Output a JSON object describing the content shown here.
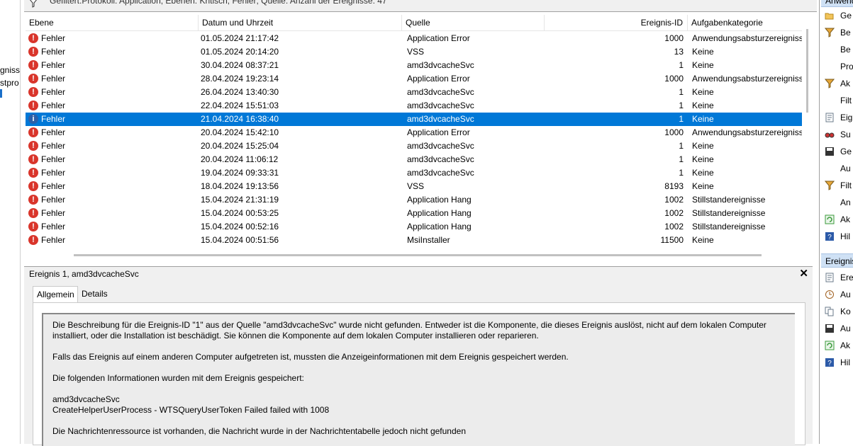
{
  "left_tree": {
    "fragments": [
      "gnisse",
      "stpro"
    ]
  },
  "filterbar": {
    "text": "Gefiltert:Protokoll: Application; Ebenen: Kritisch, Fehler; Quelle: Anzahl der Ereignisse: 47"
  },
  "table": {
    "headers": {
      "level": "Ebene",
      "date": "Datum und Uhrzeit",
      "source": "Quelle",
      "id": "Ereignis-ID",
      "category": "Aufgabenkategorie"
    },
    "rows": [
      {
        "level": "Fehler",
        "date": "01.05.2024 21:17:42",
        "source": "Application Error",
        "id": "1000",
        "category": "Anwendungsabsturzereignisse"
      },
      {
        "level": "Fehler",
        "date": "01.05.2024 20:14:20",
        "source": "VSS",
        "id": "13",
        "category": "Keine"
      },
      {
        "level": "Fehler",
        "date": "30.04.2024 08:37:21",
        "source": "amd3dvcacheSvc",
        "id": "1",
        "category": "Keine"
      },
      {
        "level": "Fehler",
        "date": "28.04.2024 19:23:14",
        "source": "Application Error",
        "id": "1000",
        "category": "Anwendungsabsturzereignisse"
      },
      {
        "level": "Fehler",
        "date": "26.04.2024 13:40:30",
        "source": "amd3dvcacheSvc",
        "id": "1",
        "category": "Keine"
      },
      {
        "level": "Fehler",
        "date": "22.04.2024 15:51:03",
        "source": "amd3dvcacheSvc",
        "id": "1",
        "category": "Keine"
      },
      {
        "level": "Fehler",
        "date": "21.04.2024 16:38:40",
        "source": "amd3dvcacheSvc",
        "id": "1",
        "category": "Keine",
        "selected": true
      },
      {
        "level": "Fehler",
        "date": "20.04.2024 15:42:10",
        "source": "Application Error",
        "id": "1000",
        "category": "Anwendungsabsturzereignisse"
      },
      {
        "level": "Fehler",
        "date": "20.04.2024 15:25:04",
        "source": "amd3dvcacheSvc",
        "id": "1",
        "category": "Keine"
      },
      {
        "level": "Fehler",
        "date": "20.04.2024 11:06:12",
        "source": "amd3dvcacheSvc",
        "id": "1",
        "category": "Keine"
      },
      {
        "level": "Fehler",
        "date": "19.04.2024 09:33:31",
        "source": "amd3dvcacheSvc",
        "id": "1",
        "category": "Keine"
      },
      {
        "level": "Fehler",
        "date": "18.04.2024 19:13:56",
        "source": "VSS",
        "id": "8193",
        "category": "Keine"
      },
      {
        "level": "Fehler",
        "date": "15.04.2024 21:31:19",
        "source": "Application Hang",
        "id": "1002",
        "category": "Stillstandereignisse"
      },
      {
        "level": "Fehler",
        "date": "15.04.2024 00:53:25",
        "source": "Application Hang",
        "id": "1002",
        "category": "Stillstandereignisse"
      },
      {
        "level": "Fehler",
        "date": "15.04.2024 00:52:16",
        "source": "Application Hang",
        "id": "1002",
        "category": "Stillstandereignisse"
      },
      {
        "level": "Fehler",
        "date": "15.04.2024 00:51:56",
        "source": "MsiInstaller",
        "id": "11500",
        "category": "Keine"
      }
    ]
  },
  "detail": {
    "title": "Ereignis 1, amd3dvcacheSvc",
    "close": "✕",
    "tabs": {
      "general": "Allgemein",
      "details": "Details"
    },
    "paragraphs": [
      "Die Beschreibung für die Ereignis-ID \"1\" aus der Quelle \"amd3dvcacheSvc\" wurde nicht gefunden. Entweder ist die Komponente, die dieses Ereignis auslöst, nicht auf dem lokalen Computer installiert, oder die Installation ist beschädigt. Sie können die Komponente auf dem lokalen Computer installieren oder reparieren.",
      "Falls das Ereignis auf einem anderen Computer aufgetreten ist, mussten die Anzeigeinformationen mit dem Ereignis gespeichert werden.",
      "Die folgenden Informationen wurden mit dem Ereignis gespeichert:",
      "amd3dvcacheSvc\nCreateHelperUserProcess - WTSQueryUserToken Failed failed with 1008",
      "Die Nachrichtenressource ist vorhanden, die Nachricht wurde in der Nachrichtentabelle jedoch nicht gefunden"
    ]
  },
  "right_pane": {
    "section1": "Anwend",
    "items1": [
      {
        "icon": "folder-open-icon",
        "label": "Ge"
      },
      {
        "icon": "filter-icon",
        "label": "Be"
      },
      {
        "icon": "",
        "label": "Be"
      },
      {
        "icon": "",
        "label": "Pro"
      },
      {
        "icon": "filter-icon",
        "label": "Ak"
      },
      {
        "icon": "",
        "label": "Filt"
      },
      {
        "icon": "properties-icon",
        "label": "Eig"
      },
      {
        "icon": "find-icon",
        "label": "Su"
      },
      {
        "icon": "save-icon",
        "label": "Ge"
      },
      {
        "icon": "",
        "label": "Au"
      },
      {
        "icon": "filter-icon",
        "label": "Filt"
      },
      {
        "icon": "",
        "label": "An"
      },
      {
        "icon": "refresh-icon",
        "label": "Ak"
      },
      {
        "icon": "help-icon",
        "label": "Hil"
      }
    ],
    "section2": "Ereignis",
    "items2": [
      {
        "icon": "properties-icon",
        "label": "Ere"
      },
      {
        "icon": "task-icon",
        "label": "Au"
      },
      {
        "icon": "copy-icon",
        "label": "Ko"
      },
      {
        "icon": "save-icon",
        "label": "Au"
      },
      {
        "icon": "refresh-icon",
        "label": "Ak"
      },
      {
        "icon": "help-icon",
        "label": "Hil"
      }
    ]
  }
}
